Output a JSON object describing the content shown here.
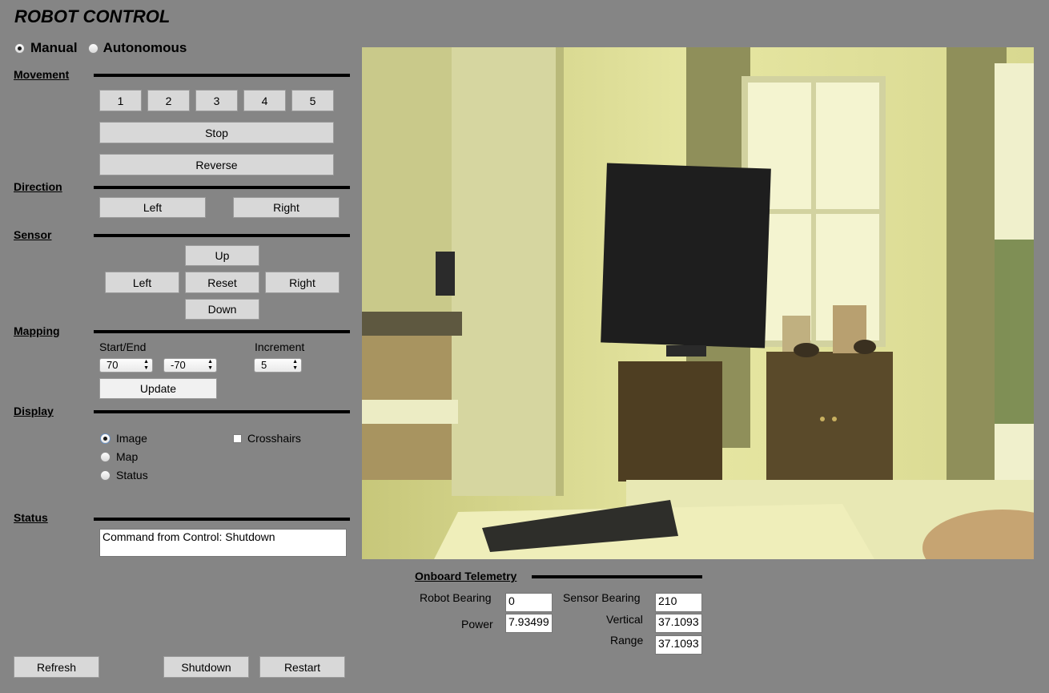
{
  "app_title": "ROBOT CONTROL",
  "mode": {
    "manual_label": "Manual",
    "autonomous_label": "Autonomous",
    "selected": "Manual"
  },
  "movement": {
    "heading": "Movement",
    "speeds": [
      "1",
      "2",
      "3",
      "4",
      "5"
    ],
    "stop_label": "Stop",
    "reverse_label": "Reverse"
  },
  "direction": {
    "heading": "Direction",
    "left_label": "Left",
    "right_label": "Right"
  },
  "sensor": {
    "heading": "Sensor",
    "up_label": "Up",
    "left_label": "Left",
    "reset_label": "Reset",
    "right_label": "Right",
    "down_label": "Down"
  },
  "mapping": {
    "heading": "Mapping",
    "start_end_label": "Start/End",
    "increment_label": "Increment",
    "start_value": "70",
    "end_value": "-70",
    "increment_value": "5",
    "update_label": "Update"
  },
  "display": {
    "heading": "Display",
    "image_label": "Image",
    "map_label": "Map",
    "status_label": "Status",
    "crosshairs_label": "Crosshairs",
    "selected": "Image",
    "crosshairs_checked": false
  },
  "status": {
    "heading": "Status",
    "message": "Command from Control: Shutdown"
  },
  "telemetry": {
    "heading": "Onboard Telemetry",
    "robot_bearing_label": "Robot Bearing",
    "robot_bearing_value": "0",
    "power_label": "Power",
    "power_value": "7.93499",
    "sensor_bearing_label": "Sensor Bearing",
    "sensor_bearing_value": "210",
    "vertical_label": "Vertical",
    "vertical_value": "37.1093",
    "range_label": "Range",
    "range_value": "37.1093"
  },
  "footer": {
    "refresh_label": "Refresh",
    "shutdown_label": "Shutdown",
    "restart_label": "Restart"
  },
  "colors": {
    "background": "#858585",
    "button": "#d8d8d8",
    "camera_tint": "#dede8e"
  }
}
